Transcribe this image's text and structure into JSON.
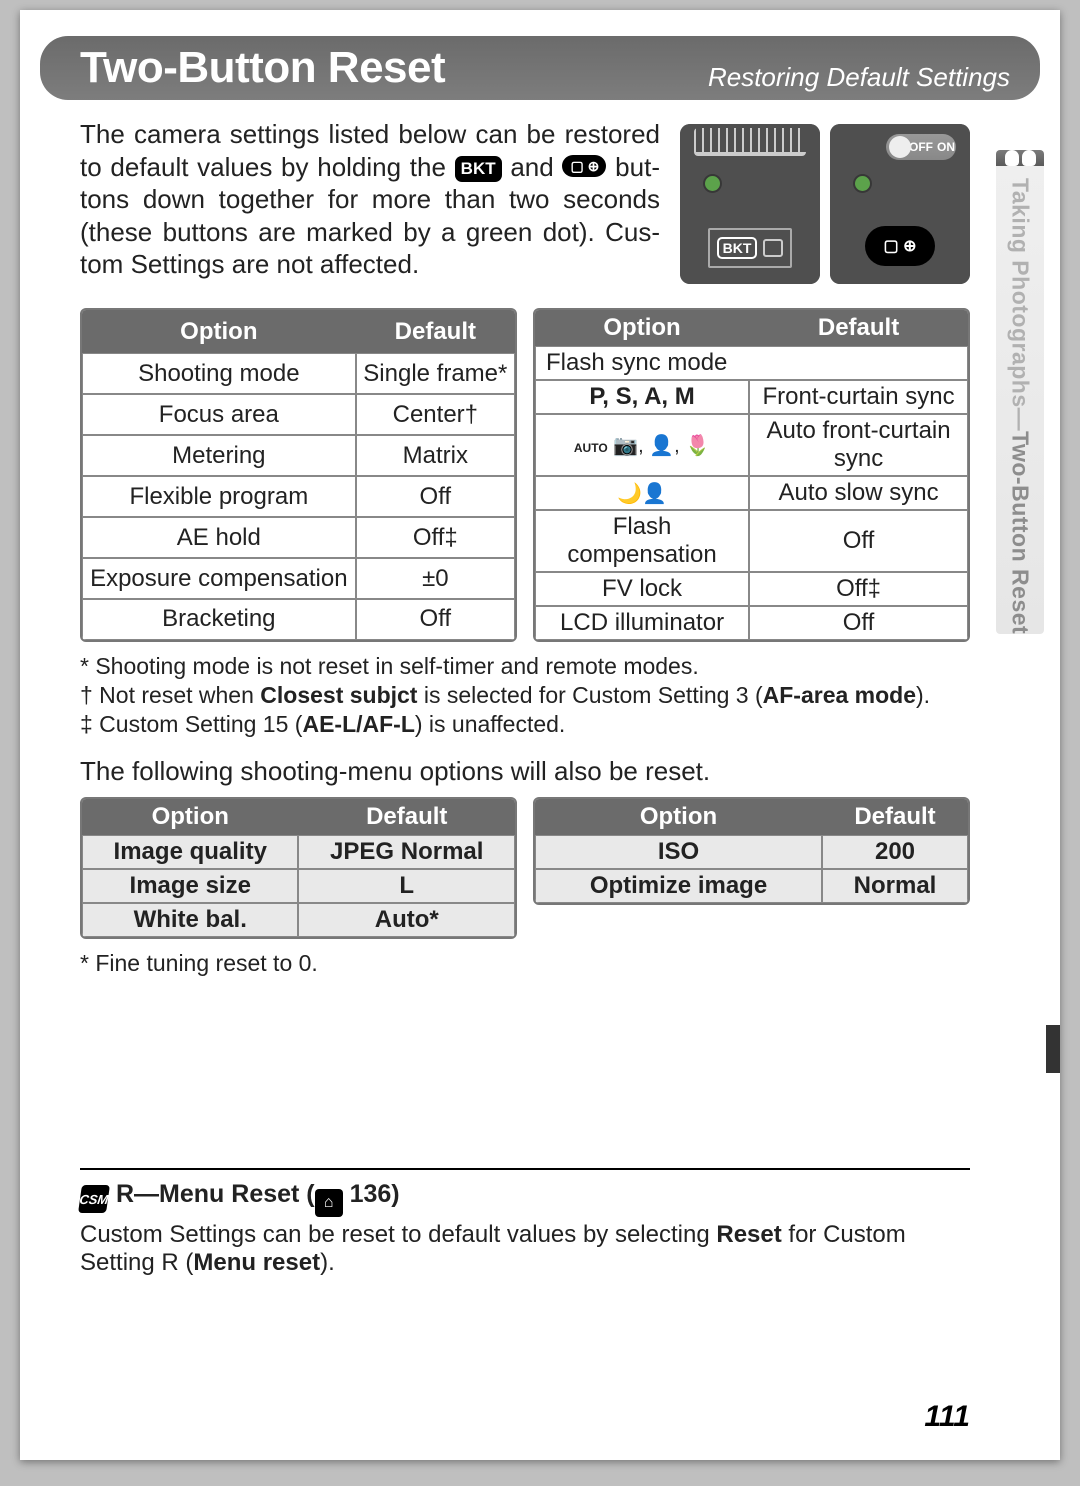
{
  "header": {
    "title": "Two-Button Reset",
    "subtitle": "Restoring Default Settings"
  },
  "side_tab": {
    "line1": "Taking Photographs—",
    "line2": "Two-Button Reset"
  },
  "intro": {
    "part1": "The camera settings listed below can be restored to default values by holding the ",
    "bkt": "BKT",
    "part2": " and ",
    "part3": " but­tons down together for more than two seconds (these buttons are marked by a green dot).  Cus­tom Settings are not affected."
  },
  "diagram1": {
    "label": "BKT"
  },
  "diagram2": {
    "off": "OFF",
    "on": "ON",
    "af": "▢ ⊕"
  },
  "tables1": {
    "left": {
      "headers": {
        "option": "Option",
        "default": "Default"
      },
      "rows": [
        {
          "option": "Shooting mode",
          "default": "Single frame*"
        },
        {
          "option": "Focus area",
          "default": "Center†"
        },
        {
          "option": "Metering",
          "default": "Matrix"
        },
        {
          "option": "Flexible program",
          "default": "Off"
        },
        {
          "option": "AE hold",
          "default": "Off‡"
        },
        {
          "option": "Exposure compensation",
          "default": "±0"
        },
        {
          "option": "Bracketing",
          "default": "Off"
        }
      ]
    },
    "right": {
      "headers": {
        "option": "Option",
        "default": "Default"
      },
      "subhead": "Flash sync mode",
      "rows": [
        {
          "option": "P, S, A, M",
          "default": "Front-curtain sync",
          "bold": true
        },
        {
          "option_icons": "auto-scene-flower",
          "default": "Auto front-curtain sync"
        },
        {
          "option_icons": "night-portrait",
          "default": "Auto slow sync"
        },
        {
          "option": "Flash compensation",
          "default": "Off"
        },
        {
          "option": "FV lock",
          "default": "Off‡"
        },
        {
          "option": "LCD illuminator",
          "default": "Off"
        }
      ]
    }
  },
  "footnotes1": {
    "a": "* Shooting mode is not reset in self-timer and remote modes.",
    "b_pre": "† Not reset when ",
    "b_b1": "Closest subjct",
    "b_mid": " is selected for Custom Setting 3 (",
    "b_b2": "AF-area mode",
    "b_post": ").",
    "c_pre": "‡ Custom Setting 15 (",
    "c_b": "AE-L/AF-L",
    "c_post": ") is unaffected."
  },
  "section_text": "The following shooting-menu options will also be reset.",
  "tables2": {
    "left": {
      "headers": {
        "option": "Option",
        "default": "Default"
      },
      "rows": [
        {
          "option": "Image quality",
          "default": "JPEG Normal"
        },
        {
          "option": "Image size",
          "default": "L"
        },
        {
          "option": "White bal.",
          "default": "Auto*"
        }
      ]
    },
    "right": {
      "headers": {
        "option": "Option",
        "default": "Default"
      },
      "rows": [
        {
          "option": "ISO",
          "default": "200"
        },
        {
          "option": "Optimize image",
          "default": "Normal"
        }
      ]
    }
  },
  "footnotes2": {
    "a": "* Fine tuning reset to 0."
  },
  "bottom_box": {
    "csm": "CSM",
    "hdr_text": "R—Menu Reset (",
    "pageicon": "⌂",
    "hdr_num": "136)",
    "body_pre": "Custom Settings can be reset to default values by selecting ",
    "body_b1": "Reset",
    "body_mid": " for Custom Setting R (",
    "body_b2": "Menu reset",
    "body_post": ")."
  },
  "page_number": "111"
}
